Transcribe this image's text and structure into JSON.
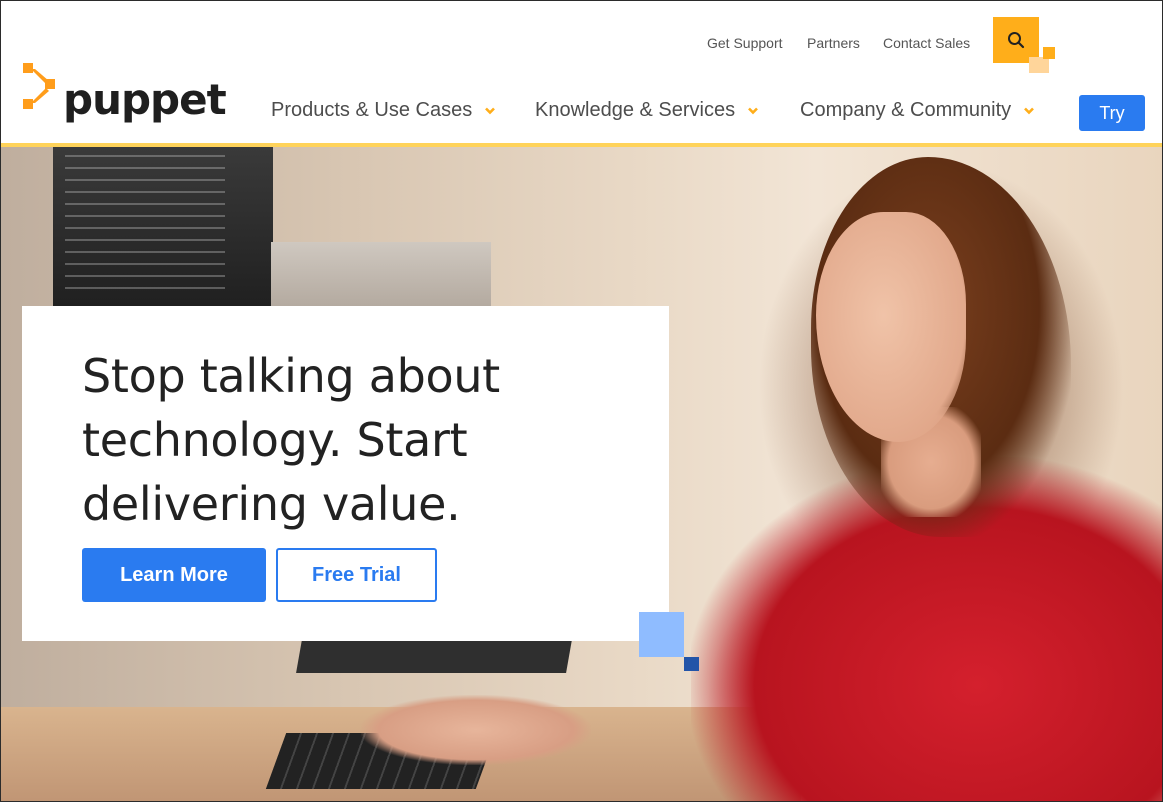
{
  "brand": {
    "name": "puppet",
    "accent": "#ffae1a",
    "blue": "#2a7bf0"
  },
  "utility_nav": [
    "Get Support",
    "Partners",
    "Contact Sales"
  ],
  "main_nav": [
    "Products & Use Cases",
    "Knowledge & Services",
    "Company & Community"
  ],
  "try_label": "Try",
  "hero": {
    "headline": "Stop talking about technology. Start delivering value.",
    "primary_button": "Learn More",
    "secondary_button": "Free Trial"
  },
  "icons": {
    "search": "search-icon",
    "chevron": "chevron-down-icon",
    "logo": "puppet-logo-icon"
  }
}
